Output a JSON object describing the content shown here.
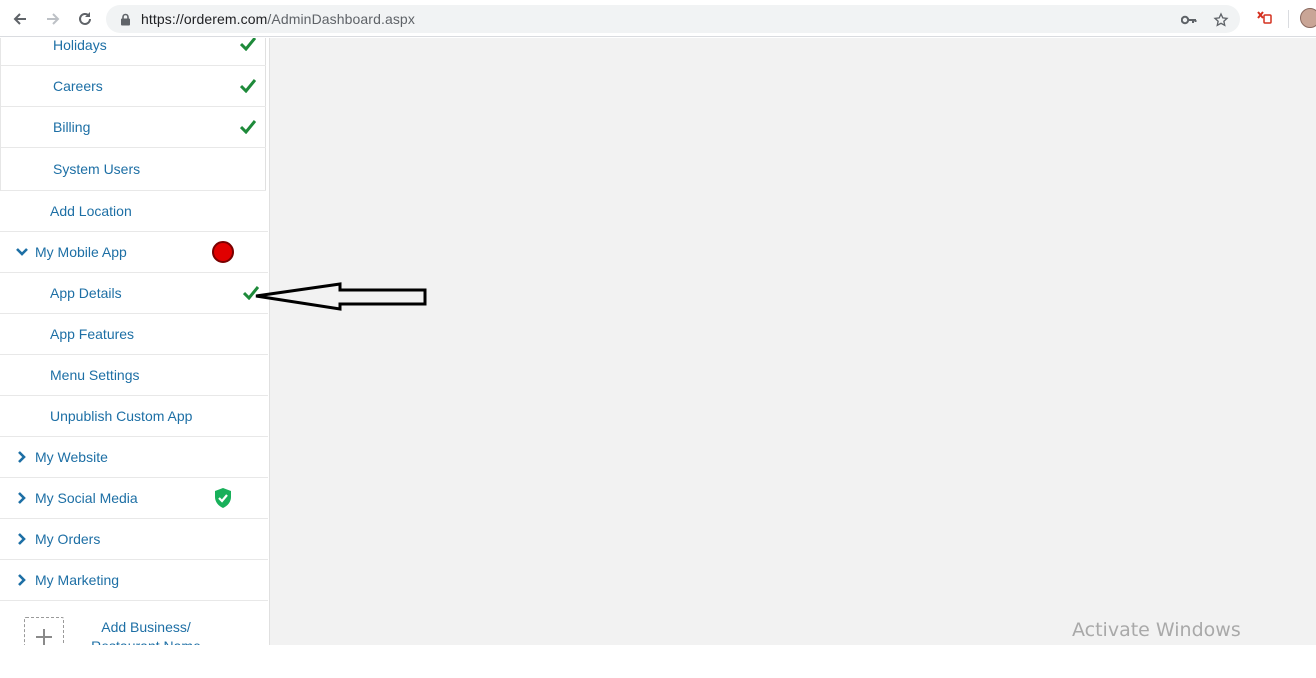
{
  "browser": {
    "url_host": "https://orderem.com",
    "url_path": "/AdminDashboard.aspx"
  },
  "sidebar": {
    "settings_items": [
      {
        "label": "Holidays",
        "checked": true
      },
      {
        "label": "Careers",
        "checked": true
      },
      {
        "label": "Billing",
        "checked": true
      },
      {
        "label": "System Users",
        "checked": false
      }
    ],
    "add_location": "Add Location",
    "mobile_app": {
      "label": "My Mobile App",
      "expanded": true,
      "status_color": "#e00000",
      "items": [
        {
          "label": "App Details",
          "checked": true
        },
        {
          "label": "App Features"
        },
        {
          "label": "Menu Settings"
        },
        {
          "label": "Unpublish Custom App"
        }
      ]
    },
    "sections": [
      {
        "label": "My Website"
      },
      {
        "label": "My Social Media",
        "verified": true
      },
      {
        "label": "My Orders"
      },
      {
        "label": "My Marketing"
      }
    ],
    "add_business_label": "Add Business/ Restaurant Name"
  },
  "overlay": {
    "watermark": "Activate Windows"
  },
  "colors": {
    "link": "#1d6fa5",
    "check": "#1e8a3a",
    "shield": "#18b05a",
    "main_bg": "#f2f2f2"
  }
}
